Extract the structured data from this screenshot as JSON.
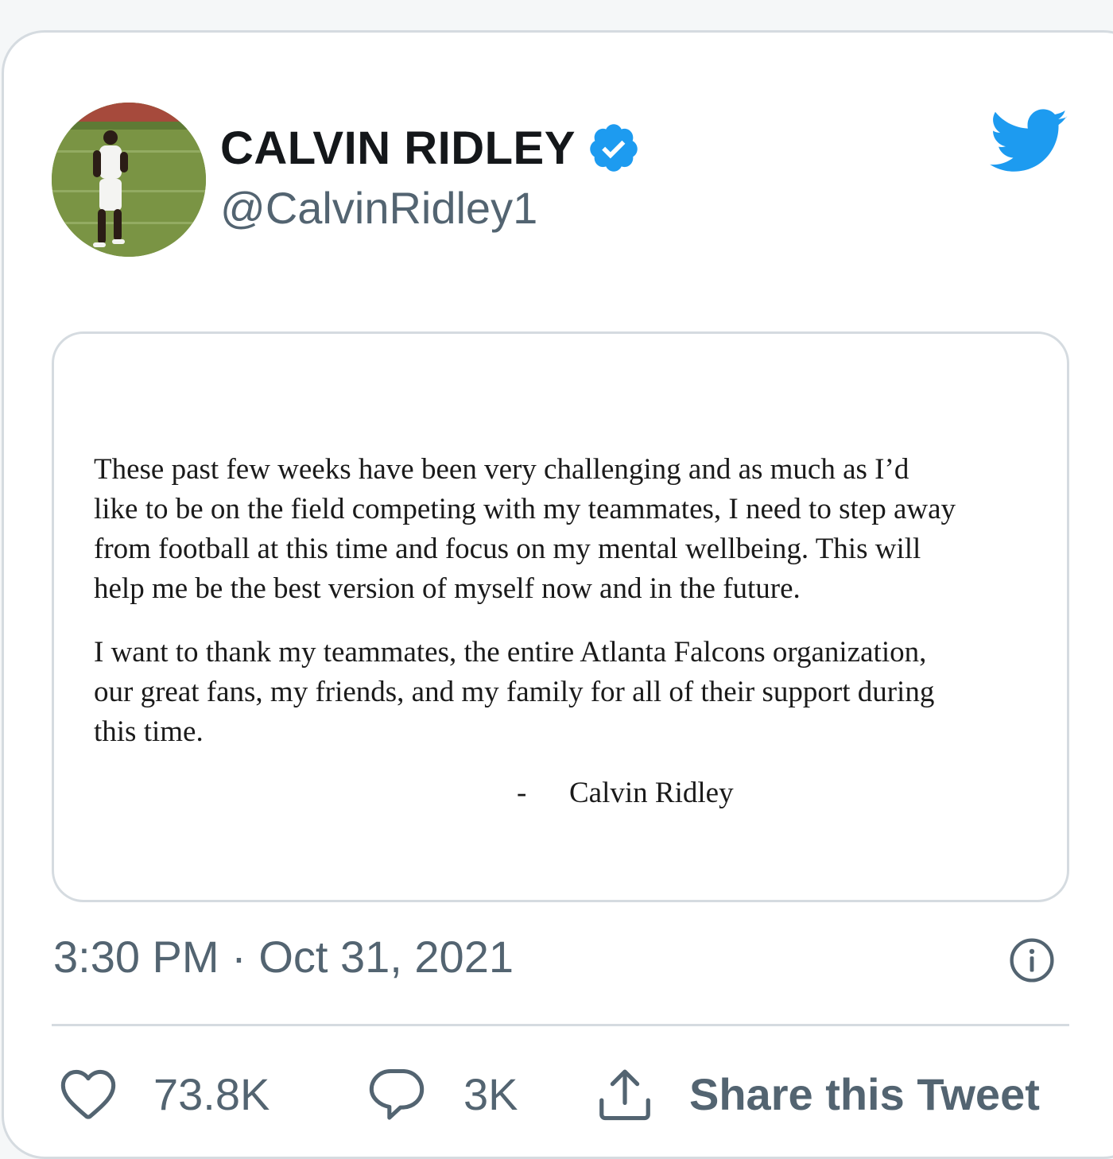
{
  "author": {
    "display_name": "CALVIN RIDLEY",
    "handle": "@CalvinRidley1",
    "verified_icon": "verified-badge-icon",
    "avatar": "avatar-photo"
  },
  "brand": {
    "logo_icon": "twitter-bird-icon",
    "accent_color": "#1d9bf0"
  },
  "statement": {
    "paragraph_1_lines": [
      "These past few weeks have been very challenging and as much as I’d",
      "like to be on the field competing with my teammates, I need to step away",
      "from football at this time and focus on my mental wellbeing.  This will",
      "help me be the best version of myself now and in the future."
    ],
    "paragraph_2_lines": [
      "I want to thank my teammates, the entire Atlanta Falcons organization,",
      "our great fans, my friends, and my family for all of their support during",
      "this time."
    ],
    "signature_dash": "-",
    "signature_name": "Calvin Ridley"
  },
  "meta": {
    "timestamp": "3:30 PM · Oct 31, 2021",
    "info_icon": "info-icon"
  },
  "actions": {
    "like_count": "73.8K",
    "reply_count": "3K",
    "share_label": "Share this Tweet",
    "like_icon": "heart-icon",
    "reply_icon": "reply-bubble-icon",
    "share_icon": "share-icon"
  }
}
